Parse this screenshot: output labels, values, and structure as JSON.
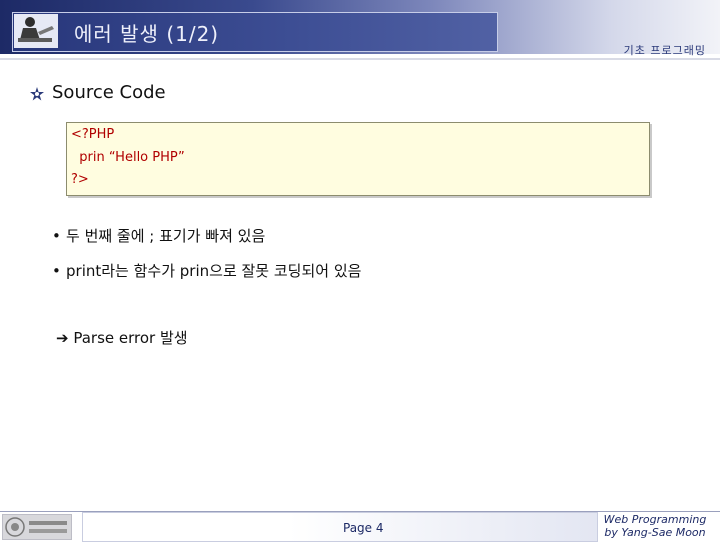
{
  "header": {
    "title": "에러 발생 (1/2)",
    "course": "기초 프로그래밍",
    "logo_icon": "teacher-at-desk-icon"
  },
  "content": {
    "section_icon": "star-bullet-icon",
    "heading": "Source Code",
    "code_lines": [
      "<?PHP",
      "  prin “Hello PHP”",
      "?>"
    ],
    "bullets": [
      "두 번째 줄에 ; 표기가 빠져 있음",
      "print라는 함수가 prin으로 잘못 코딩되어 있음"
    ],
    "conclusion_arrow": "➔",
    "conclusion": "Parse error 발생"
  },
  "footer": {
    "logo_icon": "university-logo-icon",
    "page": "Page 4",
    "credit_line1": "Web Programming",
    "credit_line2": "by Yang-Sae Moon"
  },
  "colors": {
    "header_dark": "#1d2a66",
    "code_text": "#b00000",
    "code_background": "#fffde0"
  }
}
